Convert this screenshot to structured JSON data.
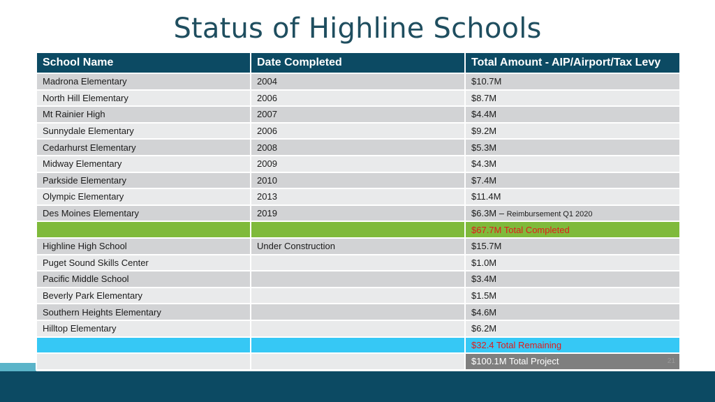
{
  "title": "Status of Highline Schools",
  "headers": [
    "School Name",
    "Date Completed",
    "Total Amount - AIP/Airport/Tax Levy"
  ],
  "rows": [
    {
      "school": "Madrona Elementary",
      "date": "2004",
      "amount": "$10.7M"
    },
    {
      "school": "North Hill Elementary",
      "date": "2006",
      "amount": "$8.7M"
    },
    {
      "school": "Mt Rainier High",
      "date": "2007",
      "amount": "$4.4M"
    },
    {
      "school": "Sunnydale Elementary",
      "date": "2006",
      "amount": "$9.2M"
    },
    {
      "school": "Cedarhurst Elementary",
      "date": "2008",
      "amount": "$5.3M"
    },
    {
      "school": "Midway Elementary",
      "date": "2009",
      "amount": "$4.3M"
    },
    {
      "school": "Parkside Elementary",
      "date": "2010",
      "amount": "$7.4M"
    },
    {
      "school": "Olympic Elementary",
      "date": "2013",
      "amount": "$11.4M"
    },
    {
      "school": "Des Moines Elementary",
      "date": "2019",
      "amount": "$6.3M –",
      "note": "Reimbursement Q1 2020"
    }
  ],
  "total_completed": "$67.7M Total Completed",
  "rows2": [
    {
      "school": "Highline High School",
      "date": "Under Construction",
      "amount": "$15.7M"
    },
    {
      "school": "Puget Sound Skills Center",
      "date": "",
      "amount": "$1.0M"
    },
    {
      "school": "Pacific Middle School",
      "date": "",
      "amount": "$3.4M"
    },
    {
      "school": "Beverly Park Elementary",
      "date": "",
      "amount": "$1.5M"
    },
    {
      "school": "Southern Heights Elementary",
      "date": "",
      "amount": "$4.6M"
    },
    {
      "school": "Hilltop Elementary",
      "date": "",
      "amount": "$6.2M"
    }
  ],
  "total_remaining": "$32.4 Total Remaining",
  "total_project": "$100.1M Total Project",
  "page_number": "21",
  "colors": {
    "header": "#0c4a63",
    "title": "#1f4e5f",
    "completed_row": "#7fba3b",
    "remaining_row": "#36c8f5",
    "total_text": "#e11b1b",
    "project_cell": "#7f7f7f"
  }
}
